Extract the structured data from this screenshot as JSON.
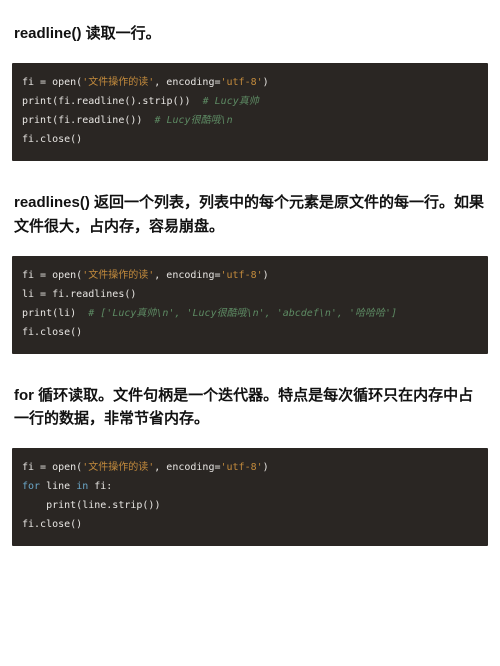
{
  "sections": [
    {
      "heading": "readline() 读取一行。",
      "code": [
        [
          {
            "cls": "tok-default",
            "t": "fi = open("
          },
          {
            "cls": "tok-str",
            "t": "'文件操作的读'"
          },
          {
            "cls": "tok-default",
            "t": ", encoding="
          },
          {
            "cls": "tok-str",
            "t": "'utf-8'"
          },
          {
            "cls": "tok-default",
            "t": ")"
          }
        ],
        [
          {
            "cls": "tok-default",
            "t": "print(fi.readline().strip())  "
          },
          {
            "cls": "tok-cmt",
            "t": "# Lucy真帅"
          }
        ],
        [
          {
            "cls": "tok-default",
            "t": "print(fi.readline())  "
          },
          {
            "cls": "tok-cmt",
            "t": "# Lucy很酷哦\\n"
          }
        ],
        [
          {
            "cls": "tok-default",
            "t": "fi.close()"
          }
        ]
      ]
    },
    {
      "heading": "readlines() 返回一个列表，列表中的每个元素是原文件的每一行。如果文件很大，占内存，容易崩盘。",
      "code": [
        [
          {
            "cls": "tok-default",
            "t": "fi = open("
          },
          {
            "cls": "tok-str",
            "t": "'文件操作的读'"
          },
          {
            "cls": "tok-default",
            "t": ", encoding="
          },
          {
            "cls": "tok-str",
            "t": "'utf-8'"
          },
          {
            "cls": "tok-default",
            "t": ")"
          }
        ],
        [
          {
            "cls": "tok-default",
            "t": "li = fi.readlines()"
          }
        ],
        [
          {
            "cls": "tok-default",
            "t": "print(li)  "
          },
          {
            "cls": "tok-cmt",
            "t": "# ['Lucy真帅\\n', 'Lucy很酷哦\\n', 'abcdef\\n', '哈哈哈']"
          }
        ],
        [
          {
            "cls": "tok-default",
            "t": "fi.close()"
          }
        ]
      ]
    },
    {
      "heading": "for 循环读取。文件句柄是一个迭代器。特点是每次循环只在内存中占一行的数据，非常节省内存。",
      "code": [
        [
          {
            "cls": "tok-default",
            "t": "fi = open("
          },
          {
            "cls": "tok-str",
            "t": "'文件操作的读'"
          },
          {
            "cls": "tok-default",
            "t": ", encoding="
          },
          {
            "cls": "tok-str",
            "t": "'utf-8'"
          },
          {
            "cls": "tok-default",
            "t": ")"
          }
        ],
        [
          {
            "cls": "tok-kw",
            "t": "for"
          },
          {
            "cls": "tok-default",
            "t": " line "
          },
          {
            "cls": "tok-kw",
            "t": "in"
          },
          {
            "cls": "tok-default",
            "t": " fi:"
          }
        ],
        [
          {
            "cls": "tok-default",
            "t": "    print(line.strip())"
          }
        ],
        [
          {
            "cls": "tok-default",
            "t": "fi.close()"
          }
        ]
      ]
    }
  ]
}
